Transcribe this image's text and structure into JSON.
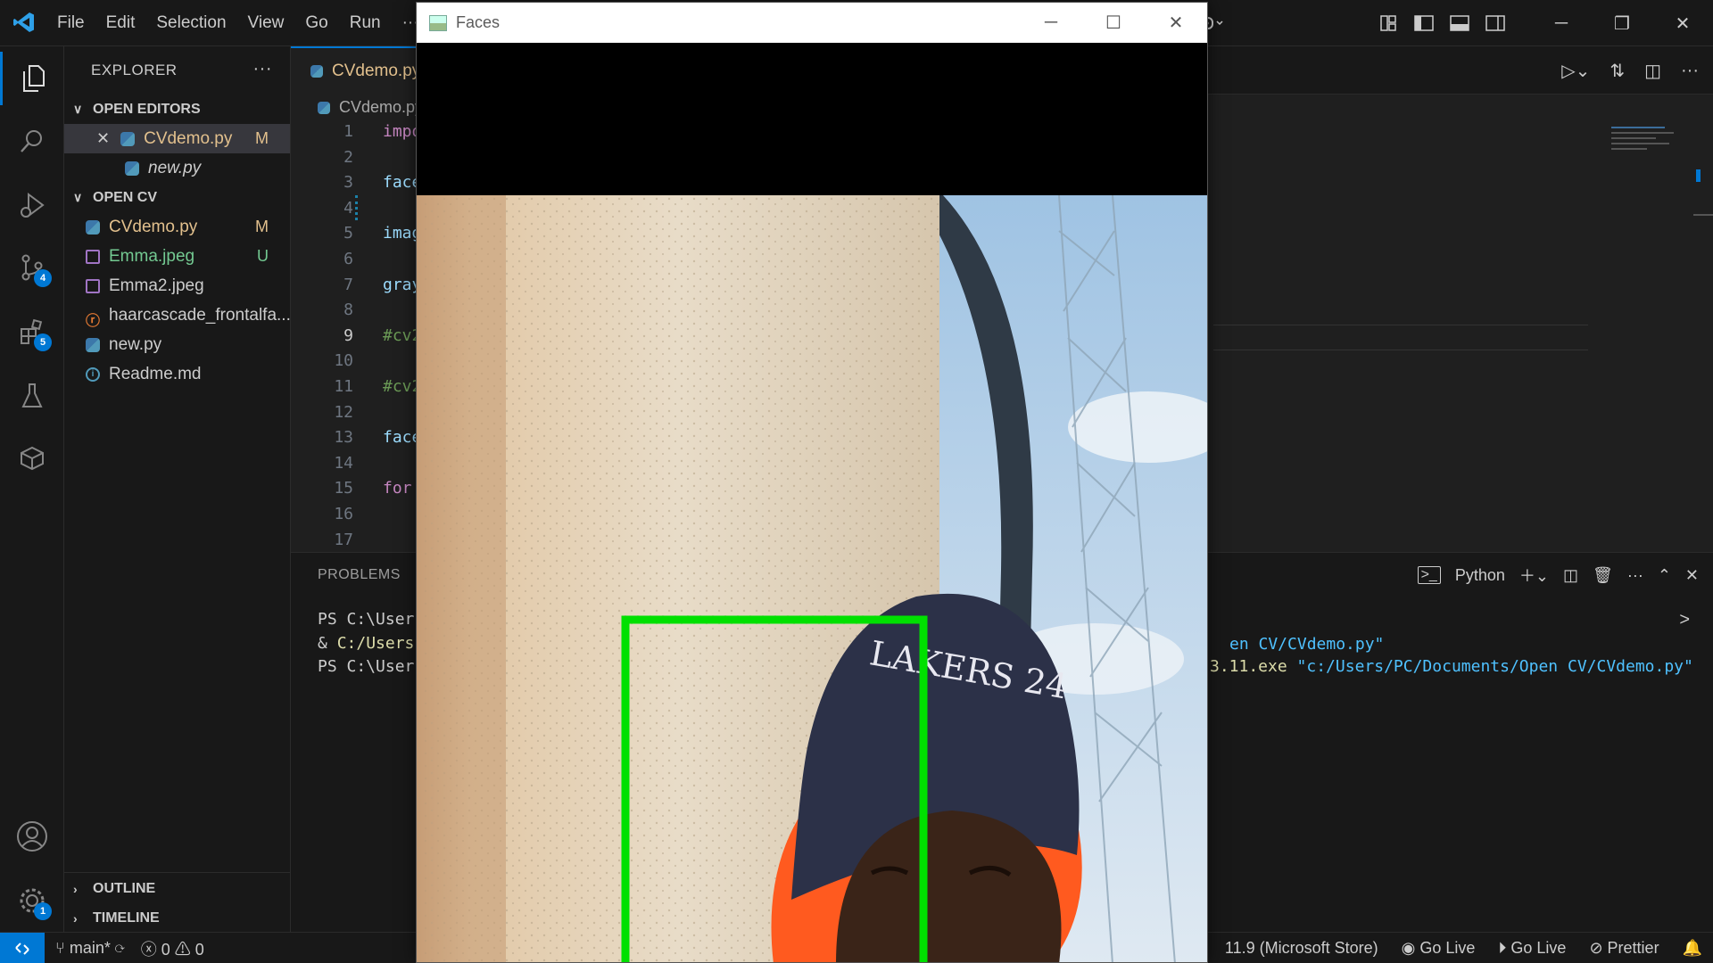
{
  "menu": [
    "File",
    "Edit",
    "Selection",
    "View",
    "Go",
    "Run",
    "···"
  ],
  "sidebar": {
    "title": "EXPLORER",
    "more": "···",
    "open_editors_label": "OPEN EDITORS",
    "open_editors": [
      {
        "name": "CVdemo.py",
        "status": "M",
        "close": "✕"
      },
      {
        "name": "new.py",
        "status": ""
      }
    ],
    "folder_label": "OPEN CV",
    "files": [
      {
        "name": "CVdemo.py",
        "status": "M"
      },
      {
        "name": "Emma.jpeg",
        "status": "U"
      },
      {
        "name": "Emma2.jpeg",
        "status": ""
      },
      {
        "name": "haarcascade_frontalfa...",
        "status": ""
      },
      {
        "name": "new.py",
        "status": ""
      },
      {
        "name": "Readme.md",
        "status": ""
      }
    ],
    "outline_label": "OUTLINE",
    "timeline_label": "TIMELINE"
  },
  "activity_badges": {
    "scm": "4",
    "extensions": "5",
    "settings": "1"
  },
  "editor": {
    "tab_label": "CVdemo.py",
    "breadcrumb": "CVdemo.py",
    "line_numbers": [
      "1",
      "2",
      "3",
      "4",
      "5",
      "6",
      "7",
      "8",
      "9",
      "10",
      "11",
      "12",
      "13",
      "14",
      "15",
      "16",
      "17"
    ],
    "current_line": "9",
    "code": {
      "l1": "impo",
      "l3": "face",
      "l5": "imag",
      "l7": "gray",
      "l9": "#cv2",
      "l11": "#cv2",
      "l13": "face",
      "l15": "for"
    }
  },
  "panel": {
    "tab": "PROBLEMS",
    "terminal_label": "Python",
    "lines": {
      "ps1": "PS C:\\User",
      "amp": "& ",
      "cmd_path": "C:/Users",
      "ps2": "PS C:\\User",
      "right1": "en CV/CVdemo.py\"",
      "right2_exe": "3.11.exe ",
      "right2_str": "\"c:/Users/PC/Documents/Open CV/CVdemo.py\""
    },
    "chevron": ">"
  },
  "statusbar": {
    "branch": "main*",
    "errors": "0",
    "warnings": "0",
    "python": "11.9 (Microsoft Store)",
    "golive1": "Go Live",
    "golive2": "Go Live",
    "prettier": "Prettier"
  },
  "faces_window": {
    "title": "Faces",
    "hat_text": "LAKERS 24",
    "detection_color": "#00e000"
  },
  "colors": {
    "accent": "#0078d4",
    "modified": "#e2c08d",
    "untracked": "#73c991"
  }
}
